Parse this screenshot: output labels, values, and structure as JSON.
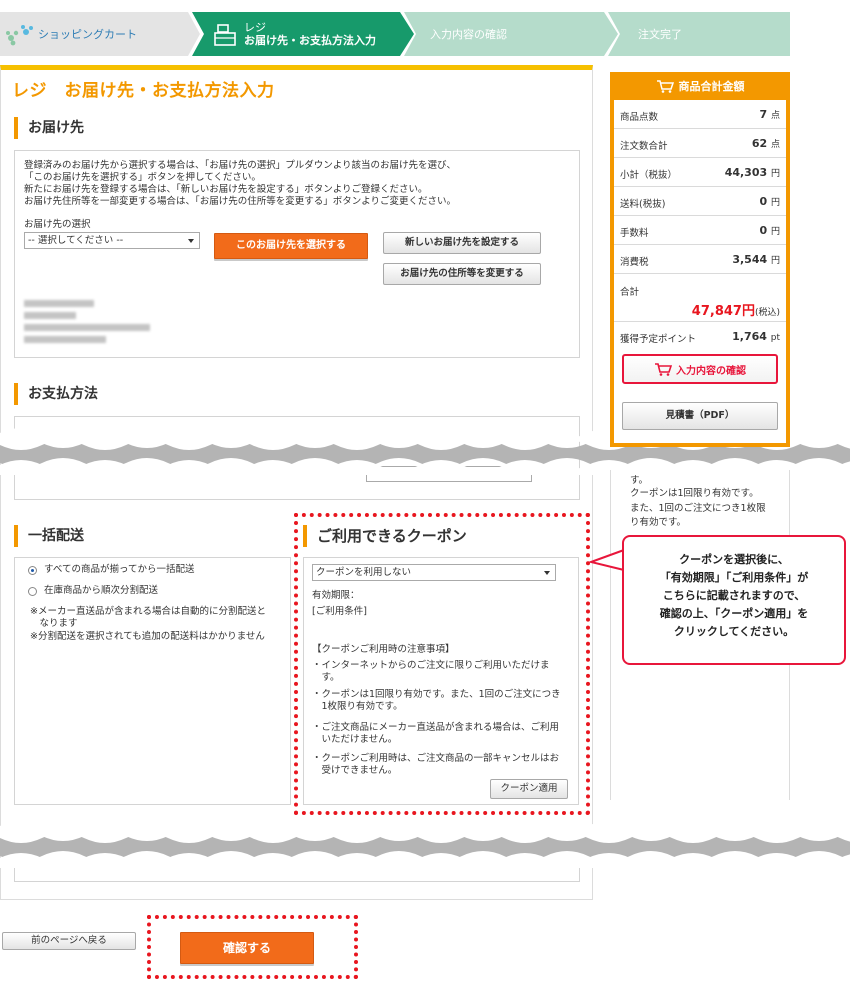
{
  "steps": {
    "cart": "ショッピングカート",
    "regi_top": "レジ",
    "regi_bottom": "お届け先・お支払方法入力",
    "confirm": "入力内容の確認",
    "complete": "注文完了"
  },
  "page_title": "レジ　お届け先・お支払方法入力",
  "delivery": {
    "heading": "お届け先",
    "instructions": [
      "登録済みのお届け先から選択する場合は、「お届け先の選択」プルダウンより該当のお届け先を選び、",
      "「このお届け先を選択する」ボタンを押してください。",
      "新たにお届け先を登録する場合は、「新しいお届け先を設定する」ボタンよりご登録ください。",
      "お届け先住所等を一部変更する場合は、「お届け先の住所等を変更する」ボタンよりご変更ください。"
    ],
    "select_label": "お届け先の選択",
    "select_value": "-- 選択してください --",
    "select_button": "このお届け先を選択する",
    "new_button": "新しいお届け先を設定する",
    "change_button": "お届け先の住所等を変更する"
  },
  "payment": {
    "heading": "お支払方法"
  },
  "bulk": {
    "heading": "一括配送",
    "options": [
      "すべての商品が揃ってから一括配送",
      "在庫商品から順次分割配送"
    ],
    "selected_index": 0,
    "notes": [
      "※メーカー直送品が含まれる場合は自動的に分割配送と",
      "　なります",
      "※分割配送を選択されても追加の配送料はかかりません"
    ]
  },
  "coupon": {
    "heading": "ご利用できるクーポン",
    "select_value": "クーポンを利用しない",
    "expiry_label": "有効期限：",
    "conditions_label": "[ご利用条件]",
    "notice_title": "【クーポンご利用時の注意事項】",
    "notices": [
      [
        "・インターネットからのご注文に限りご利用いただけま",
        "　す。"
      ],
      [
        "・クーポンは1回限り有効です。また、1回のご注文につき",
        "　1枚限り有効です。"
      ],
      [
        "・ご注文商品にメーカー直送品が含まれる場合は、ご利用",
        "　いただけません。"
      ],
      [
        "・クーポンご利用時は、ご注文商品の一部キャンセルはお",
        "　受けできません。"
      ]
    ],
    "apply_button": "クーポン適用"
  },
  "summary": {
    "heading": "商品合計金額",
    "rows": [
      {
        "label": "商品点数",
        "value": "7",
        "unit": "点"
      },
      {
        "label": "注文数合計",
        "value": "62",
        "unit": "点"
      },
      {
        "label": "小計（税抜）",
        "value": "44,303",
        "unit": "円"
      },
      {
        "label": "送料(税抜)",
        "value": "0",
        "unit": "円"
      },
      {
        "label": "手数料",
        "value": "0",
        "unit": "円"
      },
      {
        "label": "消費税",
        "value": "3,544",
        "unit": "円"
      }
    ],
    "total_label": "合計",
    "total_value": "47,847円",
    "total_note": "(税込)",
    "points_label": "獲得予定ポイント",
    "points_value": "1,764",
    "points_unit": "pt",
    "confirm_button": "入力内容の確認",
    "pdf_button": "見積書（PDF）",
    "below_text": [
      "す。",
      "クーポンは1回限り有効です。",
      "また、1回のご注文につき1枚限",
      "り有効です。"
    ]
  },
  "callout": [
    "クーポンを選択後に、",
    "「有効期限」「ご利用条件」が",
    "こちらに記載されますので、",
    "確認の上、「クーポン適用」を",
    "クリックしてください。"
  ],
  "footer": {
    "back_button": "前のページへ戻る",
    "confirm_button": "確認する"
  },
  "colors": {
    "accent": "#f39800",
    "step_active": "#179a6b",
    "step_inactive": "#b5dccb",
    "button": "#f26b1a",
    "highlight": "#e8161f",
    "total": "#e8161f"
  }
}
